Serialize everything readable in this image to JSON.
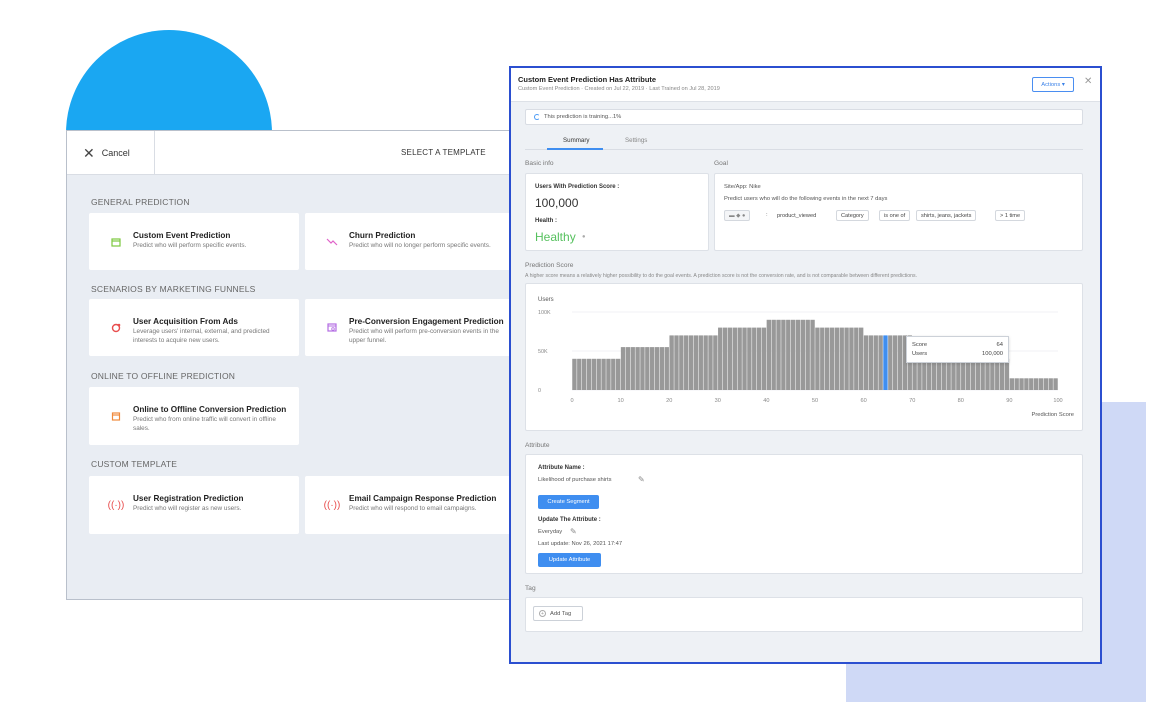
{
  "template_panel": {
    "cancel_label": "Cancel",
    "title": "SELECT A TEMPLATE",
    "sections": [
      {
        "title": "GENERAL PREDICTION"
      },
      {
        "title": "SCENARIOS BY MARKETING FUNNELS"
      },
      {
        "title": "ONLINE TO OFFLINE PREDICTION"
      },
      {
        "title": "CUSTOM TEMPLATE"
      }
    ],
    "cards": [
      {
        "title": "Custom Event Prediction",
        "desc": "Predict who will perform specific events.",
        "icon": "calendar-icon",
        "color": "#7cc83e"
      },
      {
        "title": "Churn Prediction",
        "desc": "Predict who will no longer perform specific events.",
        "icon": "trend-down-icon",
        "color": "#e062c9"
      },
      {
        "title": "User Acquisition From Ads",
        "desc": "Leverage users' internal, external, and predicted interests to acquire new users.",
        "icon": "ads-icon",
        "color": "#e84d4d"
      },
      {
        "title": "Pre-Conversion Engagement Prediction",
        "desc": "Predict who will perform pre-conversion events in the upper funnel.",
        "icon": "browser-search-icon",
        "color": "#b36de3"
      },
      {
        "title": "Online to Offline Conversion Prediction",
        "desc": "Predict who from online traffic will convert in offline sales.",
        "icon": "store-icon",
        "color": "#f08a3c"
      },
      {
        "title": "User Registration Prediction",
        "desc": "Predict who will register as new users.",
        "icon": "broadcast-icon",
        "color": "#e84d4d"
      },
      {
        "title": "Email Campaign Response Prediction",
        "desc": "Predict who will respond to email campaigns.",
        "icon": "broadcast-icon",
        "color": "#e84d4d"
      }
    ]
  },
  "prediction": {
    "title": "Custom Event Prediction Has Attribute",
    "subtitle": "Custom Event Prediction · Created on Jul 22, 2019 · Last Trained on Jul 28, 2019",
    "actions_label": "Actions ▾",
    "training_text": "This prediction is training...1%",
    "tabs": [
      "Summary",
      "Settings"
    ],
    "basic_info_label": "Basic info",
    "goal_label": "Goal",
    "users_score_label": "Users With Prediction Score :",
    "users_score_value": "100,000",
    "health_label": "Health :",
    "health_value": "Healthy",
    "site_app": "Site/App: Nike",
    "goal_desc": "Predict users who will do the following events in the next 7 days",
    "goal_chips": [
      "product_viewed",
      "Category",
      "is one of",
      "shirts, jeans, jackets",
      "> 1 time"
    ],
    "score_section_label": "Prediction Score",
    "score_desc": "A higher score means a relatively higher possibility to do the goal events. A prediction score is not the conversion rate, and is not comparable between different predictions.",
    "attribute_label": "Attribute",
    "attr_name_label": "Attribute Name :",
    "attr_name_value": "Likelihood of purchase shirts",
    "create_segment_label": "Create Segment",
    "update_attr_label": "Update The Attribute :",
    "update_freq": "Everyday",
    "last_update": "Last update: Nov 26, 2021 17:47",
    "update_btn_label": "Update Attribute",
    "tag_label": "Tag",
    "add_tag_label": "Add Tag",
    "tooltip": {
      "score_label": "Score",
      "score_value": "64",
      "users_label": "Users",
      "users_value": "100,000"
    }
  },
  "chart_data": {
    "type": "bar",
    "ylabel": "Users",
    "xlabel": "Prediction Score",
    "y_ticks": [
      "100K",
      "50K",
      "0"
    ],
    "x_ticks": [
      "0",
      "10",
      "20",
      "30",
      "40",
      "50",
      "60",
      "70",
      "80",
      "90",
      "100"
    ],
    "ylim": [
      0,
      100000
    ],
    "xlim": [
      0,
      100
    ],
    "highlight_color": "#3f8ef0",
    "bar_color": "#999999",
    "values": [
      40000,
      40000,
      40000,
      40000,
      40000,
      40000,
      40000,
      40000,
      40000,
      40000,
      55000,
      55000,
      55000,
      55000,
      55000,
      55000,
      55000,
      55000,
      55000,
      55000,
      70000,
      70000,
      70000,
      70000,
      70000,
      70000,
      70000,
      70000,
      70000,
      70000,
      80000,
      80000,
      80000,
      80000,
      80000,
      80000,
      80000,
      80000,
      80000,
      80000,
      90000,
      90000,
      90000,
      90000,
      90000,
      90000,
      90000,
      90000,
      90000,
      90000,
      80000,
      80000,
      80000,
      80000,
      80000,
      80000,
      80000,
      80000,
      80000,
      80000,
      70000,
      70000,
      70000,
      70000,
      70000,
      70000,
      70000,
      70000,
      70000,
      70000,
      45000,
      45000,
      45000,
      45000,
      45000,
      45000,
      45000,
      45000,
      45000,
      45000,
      40000,
      40000,
      40000,
      40000,
      40000,
      40000,
      40000,
      40000,
      40000,
      40000,
      15000,
      15000,
      15000,
      15000,
      15000,
      15000,
      15000,
      15000,
      15000,
      15000
    ],
    "highlight_index": 64
  }
}
